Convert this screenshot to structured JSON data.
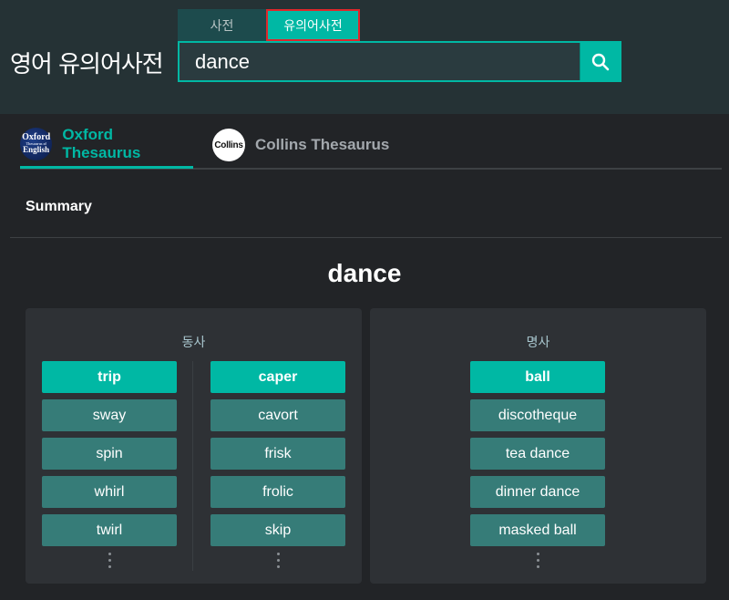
{
  "app_title": "영어 유의어사전",
  "tabs": [
    {
      "label": "사전"
    },
    {
      "label": "유의어사전"
    }
  ],
  "search": {
    "value": "dance"
  },
  "sources": [
    {
      "label": "Oxford Thesaurus"
    },
    {
      "label": "Collins Thesaurus"
    }
  ],
  "logos": {
    "oxford": {
      "l1": "Oxford",
      "l2": "Thesaurus of",
      "l3": "English"
    },
    "collins": {
      "text": "Collins"
    }
  },
  "summary_label": "Summary",
  "headword": "dance",
  "verb": {
    "label": "동사",
    "col1": [
      {
        "text": "trip",
        "primary": true
      },
      {
        "text": "sway"
      },
      {
        "text": "spin"
      },
      {
        "text": "whirl"
      },
      {
        "text": "twirl"
      }
    ],
    "col2": [
      {
        "text": "caper",
        "primary": true
      },
      {
        "text": "cavort"
      },
      {
        "text": "frisk"
      },
      {
        "text": "frolic"
      },
      {
        "text": "skip"
      }
    ]
  },
  "noun": {
    "label": "명사",
    "col1": [
      {
        "text": "ball",
        "primary": true
      },
      {
        "text": "discotheque"
      },
      {
        "text": "tea dance"
      },
      {
        "text": "dinner dance"
      },
      {
        "text": "masked ball"
      }
    ]
  },
  "colors": {
    "accent": "#00b8a4",
    "synonym_bg": "#367c78",
    "highlight_outline": "#e0262b",
    "header_bg": "#253235",
    "page_bg": "#222427"
  }
}
